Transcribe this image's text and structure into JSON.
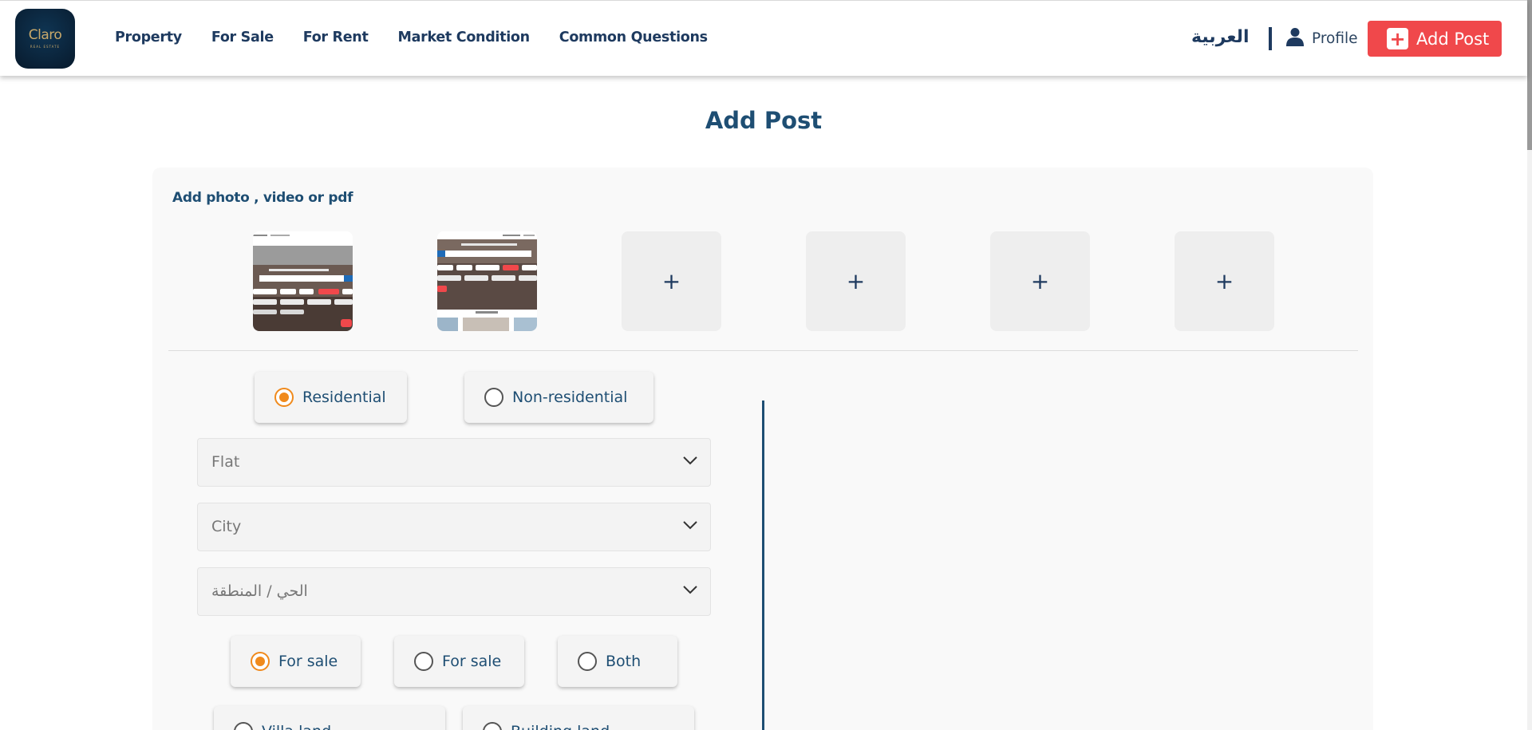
{
  "header": {
    "logo_text": "Claro",
    "logo_sub": "REAL ESTATE",
    "nav": [
      "Property",
      "For Sale",
      "For Rent",
      "Market Condition",
      "Common Questions"
    ],
    "language": "العربية",
    "profile_label": "Profile",
    "add_post_label": "Add Post",
    "accent_color": "#f0484b"
  },
  "page": {
    "title": "Add Post"
  },
  "media": {
    "label": "Add photo , video or pdf",
    "slots": [
      "thumbnail",
      "thumbnail",
      "+",
      "+",
      "+",
      "+"
    ]
  },
  "form": {
    "category_options": [
      {
        "label": "Residential",
        "checked": true
      },
      {
        "label": "Non-residential",
        "checked": false
      }
    ],
    "selects": [
      {
        "placeholder": "Flat"
      },
      {
        "placeholder": "City"
      },
      {
        "placeholder": "الحي / المنطقة"
      }
    ],
    "offer_options": [
      {
        "label": "For sale",
        "checked": true
      },
      {
        "label": "For sale",
        "checked": false
      },
      {
        "label": "Both",
        "checked": false
      }
    ],
    "next_options": [
      {
        "label": "Villa land",
        "checked": false
      },
      {
        "label": "Building land",
        "checked": false
      }
    ],
    "radio_accent": "#f08a1c"
  }
}
